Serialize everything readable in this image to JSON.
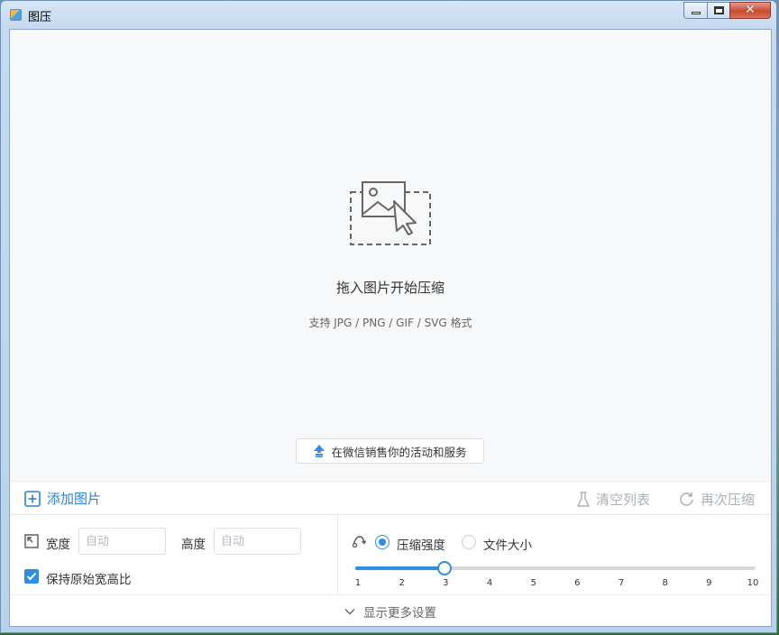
{
  "window": {
    "title": "图压"
  },
  "titlebar_buttons": {
    "minimize": "",
    "maximize": "",
    "close": "✕"
  },
  "dropzone": {
    "title": "拖入图片开始压缩",
    "subtitle": "支持 JPG / PNG / GIF / SVG 格式",
    "promo_label": "在微信销售你的活动和服务"
  },
  "toolbar": {
    "add_label": "添加图片",
    "clear_label": "清空列表",
    "recompress_label": "再次压缩"
  },
  "settings": {
    "width_label": "宽度",
    "width_placeholder": "自动",
    "height_label": "高度",
    "height_placeholder": "自动",
    "keep_ratio_label": "保持原始宽高比",
    "keep_ratio_checked": true,
    "mode_strength_label": "压缩强度",
    "mode_size_label": "文件大小",
    "selected_mode": "strength",
    "slider": {
      "min": 1,
      "max": 10,
      "value": 3
    },
    "tick_labels": [
      "1",
      "2",
      "3",
      "4",
      "5",
      "6",
      "7",
      "8",
      "9",
      "10"
    ]
  },
  "footer": {
    "more_label": "显示更多设置"
  },
  "colors": {
    "accent": "#2f8ee0",
    "link": "#2f7fd3",
    "disabled": "#aab0b8"
  }
}
